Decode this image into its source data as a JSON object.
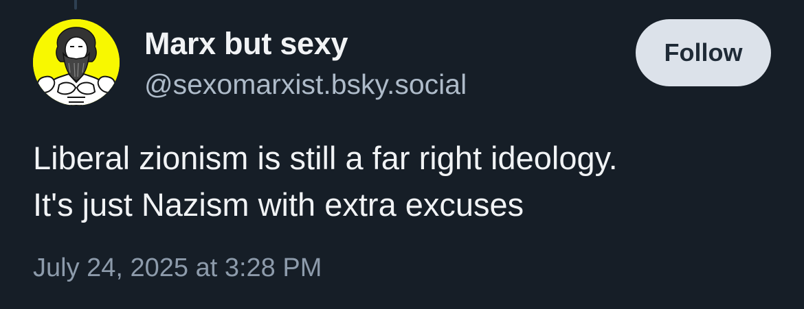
{
  "post": {
    "author": {
      "display_name": "Marx but sexy",
      "handle": "@sexomarxist.bsky.social",
      "avatar_icon": "muscular-bearded-man-avatar"
    },
    "follow_label": "Follow",
    "text_lines": [
      "Liberal zionism is still a far right ideology.",
      "It's just Nazism with extra excuses"
    ],
    "timestamp": "July 24, 2025 at 3:28 PM"
  },
  "colors": {
    "background": "#161e27",
    "avatar_background": "#f8f800",
    "primary_text": "#f1f3f5",
    "handle_text": "#aebbc9",
    "timestamp_text": "#8d9bab",
    "follow_button_bg": "#dce2ea",
    "follow_button_text": "#1f2b37",
    "thread_line": "#2e4052"
  }
}
